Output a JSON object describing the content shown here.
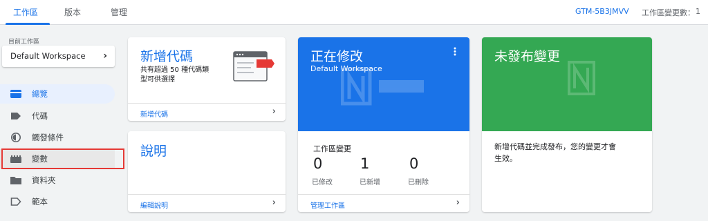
{
  "header": {
    "tabs": [
      {
        "label": "工作區"
      },
      {
        "label": "版本"
      },
      {
        "label": "管理"
      }
    ],
    "container_id": "GTM-5B3JMVV",
    "workspace_changes_label": "工作區變更數：",
    "workspace_changes_value": "1"
  },
  "sidebar": {
    "current_workspace_caption": "目前工作區",
    "workspace_name": "Default Workspace",
    "items": [
      {
        "label": "總覽",
        "icon": "overview-icon"
      },
      {
        "label": "代碼",
        "icon": "tag-icon"
      },
      {
        "label": "觸發條件",
        "icon": "trigger-icon"
      },
      {
        "label": "變數",
        "icon": "variable-icon"
      },
      {
        "label": "資料夾",
        "icon": "folder-icon"
      },
      {
        "label": "範本",
        "icon": "template-icon"
      }
    ]
  },
  "cards": {
    "new_tag": {
      "title": "新增代碼",
      "description_line1": "共有超過 50 種代碼類",
      "description_line2": "型可供選擇",
      "footer_link": "新增代碼"
    },
    "help": {
      "title": "說明",
      "footer_link": "編輯說明"
    },
    "editing": {
      "title": "正在修改",
      "subtitle": "Default Workspace",
      "changes_heading": "工作區變更",
      "stats": [
        {
          "value": "0",
          "label": "已修改"
        },
        {
          "value": "1",
          "label": "已新增"
        },
        {
          "value": "0",
          "label": "已刪除"
        }
      ],
      "footer_link": "管理工作區"
    },
    "unpublished": {
      "title": "未發布變更",
      "message_line1": "新增代碼並完成發布，您的變更才會",
      "message_line2": "生效。"
    }
  },
  "colors": {
    "accent": "#1a73e8",
    "editing_card": "#1a73e8",
    "unpublished_card": "#34a853",
    "highlight_box": "#e53935"
  }
}
